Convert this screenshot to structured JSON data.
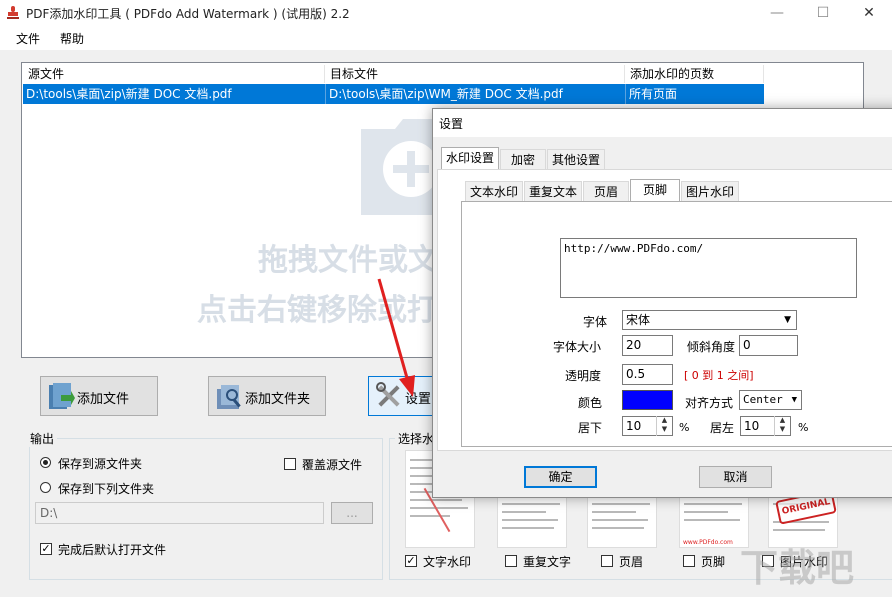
{
  "window": {
    "title": "PDF添加水印工具 ( PDFdo Add Watermark ) (试用版) 2.2"
  },
  "menu": {
    "file": "文件",
    "help": "帮助"
  },
  "filelist": {
    "columns": [
      "源文件",
      "目标文件",
      "添加水印的页数"
    ],
    "rows": [
      [
        "D:\\tools\\桌面\\zip\\新建 DOC 文档.pdf",
        "D:\\tools\\桌面\\zip\\WM_新建 DOC 文档.pdf",
        "所有页面"
      ]
    ],
    "hint_line1": "拖拽文件或文",
    "hint_line2": "点击右键移除或打"
  },
  "buttons": {
    "add_file": "添加文件",
    "add_folder": "添加文件夹",
    "settings": "设置"
  },
  "output": {
    "title": "输出",
    "save_source": "保存到源文件夹",
    "overwrite": "覆盖源文件",
    "save_to": "保存到下列文件夹",
    "path": "D:\\",
    "browse": "...",
    "open_after": "完成后默认打开文件"
  },
  "select": {
    "title": "选择水",
    "opts": [
      "文字水印",
      "重复文字",
      "页眉",
      "页脚",
      "图片水印"
    ],
    "thumb_footer_text": "www.PDFdo.com",
    "stamp_text": "ORIGINAL"
  },
  "dialog": {
    "title": "设置",
    "tabs": [
      "水印设置",
      "加密",
      "其他设置"
    ],
    "subtabs": [
      "文本水印",
      "重复文本",
      "页眉",
      "页脚",
      "图片水印"
    ],
    "text_value": "http://www.PDFdo.com/",
    "font_label": "字体",
    "font_value": "宋体",
    "size_label": "字体大小",
    "size_value": "20",
    "angle_label": "倾斜角度",
    "angle_value": "0",
    "opacity_label": "透明度",
    "opacity_value": "0.5",
    "opacity_hint": "[ 0 到 1 之间]",
    "color_label": "颜色",
    "color_value": "#0000ff",
    "align_label": "对齐方式",
    "align_value": "Center",
    "bottom_label": "居下",
    "bottom_value": "10",
    "left_label": "居左",
    "left_value": "10",
    "percent": "%",
    "ok": "确定",
    "cancel": "取消"
  },
  "corner_logo": "下载吧"
}
